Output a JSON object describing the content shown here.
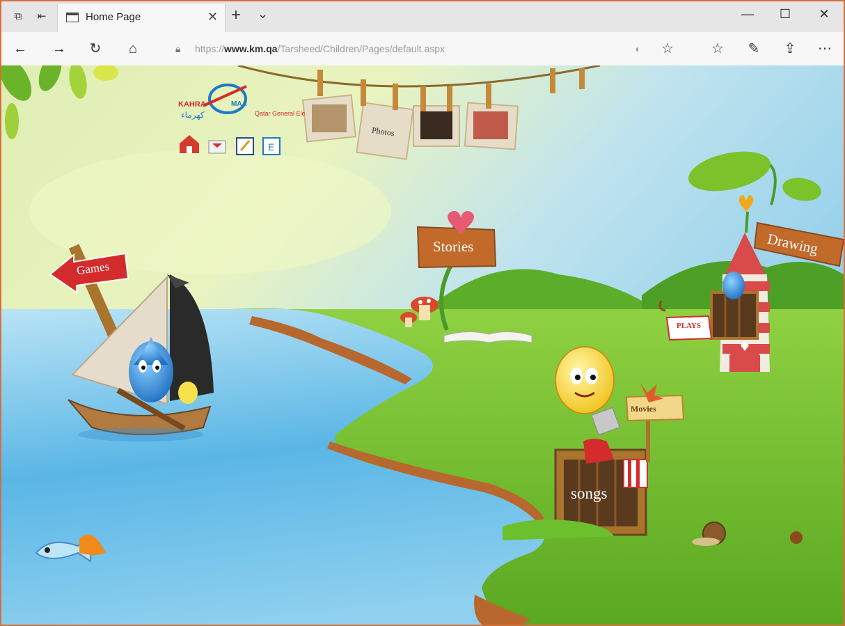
{
  "browser": {
    "tab_title": "Home Page",
    "url_prefix": "https://",
    "url_domain": "www.km.qa",
    "url_path": "/Tarsheed/Children/Pages/default.aspx"
  },
  "logo": {
    "left_text": "KAHRA",
    "right_text": "MAA",
    "english_text": "Qatar General Ele",
    "arabic_text": "كهرماء"
  },
  "nav": {
    "games": "Games",
    "stories": "Stories",
    "drawing": "Drawing",
    "plays": "PLAYS",
    "movies": "Movies",
    "songs": "songs",
    "photos": "Photos"
  },
  "page_icons": [
    "home-icon",
    "mail-icon",
    "edit-icon",
    "english-icon"
  ],
  "colors": {
    "accent_orange": "#d4703a",
    "sky": "#9ed3ee",
    "grass": "#6cc02e",
    "water": "#4fb0e0",
    "games_red": "#d42c2c",
    "sign_wood": "#c26a2a"
  }
}
